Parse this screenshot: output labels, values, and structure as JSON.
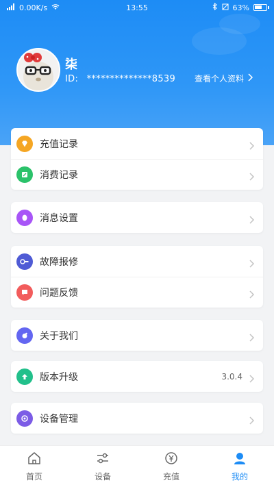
{
  "status_bar": {
    "speed": "0.00K/s",
    "time": "13:55",
    "battery": "63%"
  },
  "profile": {
    "name": "柒",
    "id_label": "ID:",
    "id_value": "**************8539",
    "view_profile": "查看个人资料"
  },
  "menu_groups": [
    {
      "items": [
        {
          "label": "充值记录",
          "icon": "diamond-icon",
          "color": "#f5a623"
        },
        {
          "label": "消费记录",
          "icon": "receipt-icon",
          "color": "#2bc26a"
        }
      ]
    },
    {
      "items": [
        {
          "label": "消息设置",
          "icon": "message-icon",
          "color": "#a855f7"
        }
      ]
    },
    {
      "items": [
        {
          "label": "故障报修",
          "icon": "repair-icon",
          "color": "#4f5bd5"
        },
        {
          "label": "问题反馈",
          "icon": "feedback-icon",
          "color": "#f25c5c"
        }
      ]
    },
    {
      "items": [
        {
          "label": "关于我们",
          "icon": "about-icon",
          "color": "#6366f1"
        }
      ]
    },
    {
      "items": [
        {
          "label": "版本升级",
          "icon": "upgrade-icon",
          "color": "#22c08b",
          "value": "3.0.4"
        }
      ]
    },
    {
      "items": [
        {
          "label": "设备管理",
          "icon": "device-icon",
          "color": "#7c5ce6"
        }
      ]
    }
  ],
  "tabs": [
    {
      "label": "首页",
      "icon": "home-icon",
      "active": false
    },
    {
      "label": "设备",
      "icon": "device-sliders-icon",
      "active": false
    },
    {
      "label": "充值",
      "icon": "recharge-icon",
      "active": false
    },
    {
      "label": "我的",
      "icon": "profile-icon",
      "active": true
    }
  ],
  "colors": {
    "header": "#1d8cf5",
    "active_tab": "#1d8cf5"
  }
}
